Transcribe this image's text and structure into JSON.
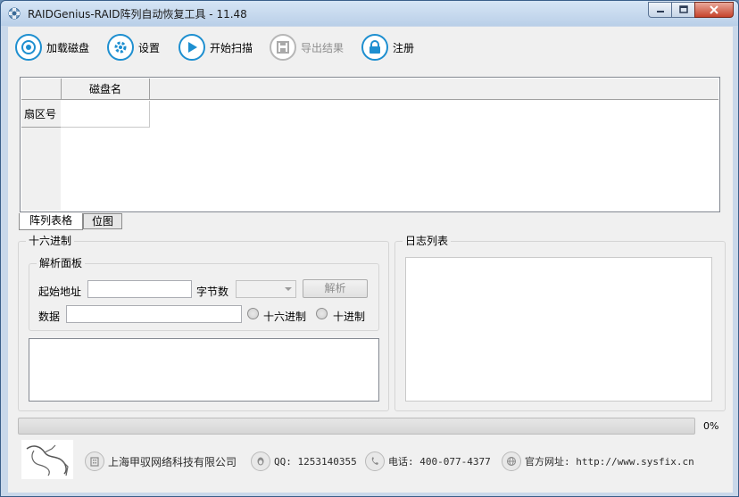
{
  "window": {
    "title": "RAIDGenius-RAID阵列自动恢复工具 - 11.48"
  },
  "toolbar": {
    "load_disk": "加载磁盘",
    "settings": "设置",
    "start_scan": "开始扫描",
    "export_result": "导出结果",
    "register": "注册"
  },
  "grid": {
    "column_headers": [
      "磁盘名"
    ],
    "row_headers": [
      "扇区号"
    ]
  },
  "tabs": [
    {
      "label": "阵列表格",
      "active": true
    },
    {
      "label": "位图",
      "active": false
    }
  ],
  "hex_panel": {
    "title": "十六进制",
    "parse_panel": {
      "title": "解析面板",
      "start_addr_label": "起始地址",
      "start_addr_value": "",
      "byte_count_label": "字节数",
      "byte_count_value": "",
      "parse_button": "解析",
      "data_label": "数据",
      "data_value": "",
      "radio_hex": "十六进制",
      "radio_dec": "十进制"
    }
  },
  "log_panel": {
    "title": "日志列表"
  },
  "progress": {
    "percent": 0,
    "text": "0%"
  },
  "footer": {
    "company": "上海甲驭网络科技有限公司",
    "qq": "QQ: 1253140355",
    "phone": "电话: 400-077-4377",
    "website": "官方网址: http://www.sysfix.cn"
  },
  "colors": {
    "accent": "#1e8fd0",
    "disabled": "#8e8e8e",
    "progress_fill": "#52b12d"
  }
}
